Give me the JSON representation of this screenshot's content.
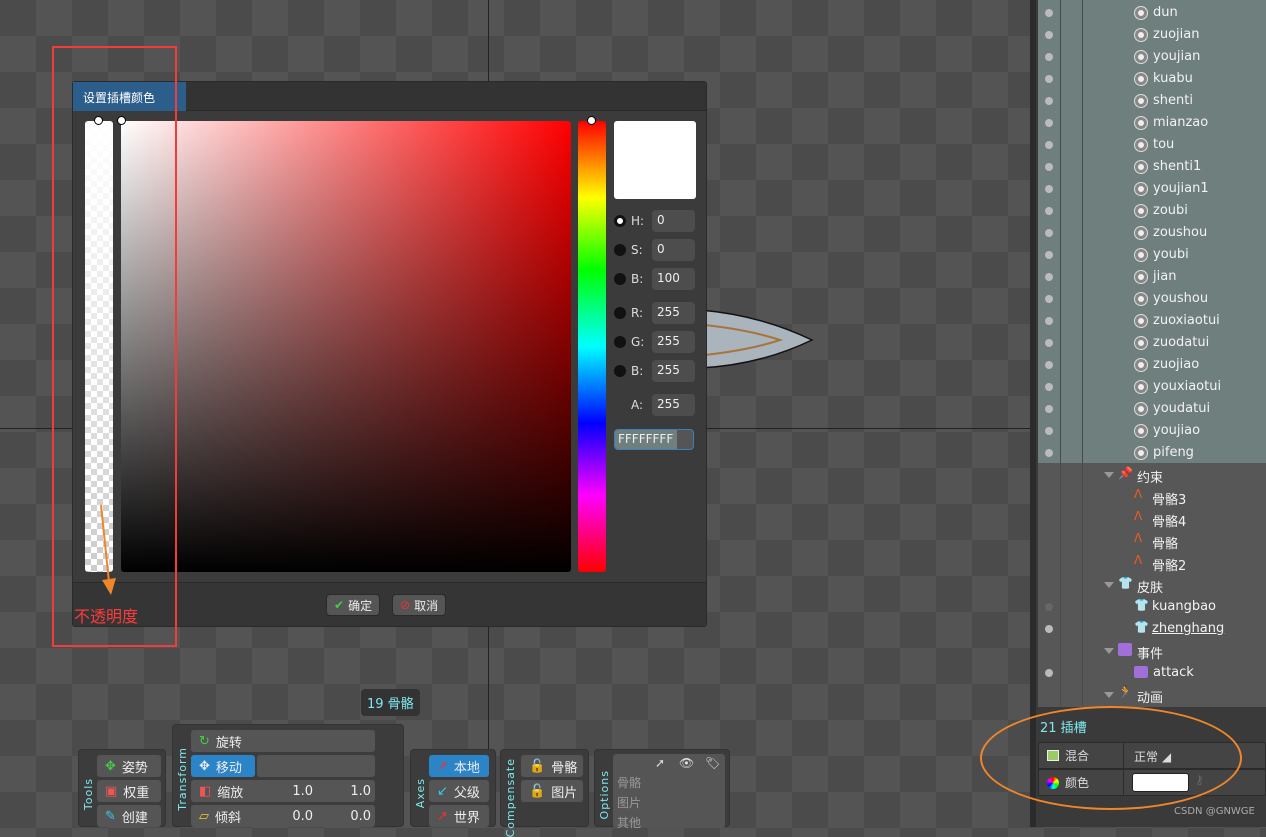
{
  "dialog": {
    "title": "设置插槽颜色",
    "fields": [
      {
        "label": "H:",
        "value": "0",
        "selected": true
      },
      {
        "label": "S:",
        "value": "0"
      },
      {
        "label": "B:",
        "value": "100"
      },
      {
        "label": "R:",
        "value": "255"
      },
      {
        "label": "G:",
        "value": "255"
      },
      {
        "label": "B:",
        "value": "255"
      }
    ],
    "alpha": {
      "label": "A:",
      "value": "255"
    },
    "hex": "FFFFFFFF",
    "ok": "确定",
    "cancel": "取消",
    "color": "#FFFFFF"
  },
  "annotation": {
    "text": "不透明度",
    "color": "#ff3a3a"
  },
  "viewport": {
    "bones_count": "19 骨骼"
  },
  "tree": {
    "slots": [
      "dun",
      "zuojian",
      "youjian",
      "kuabu",
      "shenti",
      "mianzao",
      "tou",
      "shenti1",
      "youjian1",
      "zoubi",
      "zoushou",
      "youbi",
      "jian",
      "youshou",
      "zuoxiaotui",
      "zuodatui",
      "zuojiao",
      "youxiaotui",
      "youdatui",
      "youjiao",
      "pifeng"
    ],
    "constraints": {
      "label": "约束",
      "items": [
        "骨骼3",
        "骨骼4",
        "骨骼",
        "骨骼2"
      ]
    },
    "skins": {
      "label": "皮肤",
      "items": [
        "kuangbao",
        "zhenghang"
      ]
    },
    "events": {
      "label": "事件",
      "items": [
        "attack"
      ]
    },
    "animations": {
      "label": "动画"
    }
  },
  "properties": {
    "title": "21 插槽",
    "blend_label": "混合",
    "blend_value": "正常",
    "color_label": "颜色",
    "color_value": "#FFFFFF"
  },
  "toolbar": {
    "tools": {
      "label": "Tools",
      "items": [
        "姿势",
        "权重",
        "创建"
      ]
    },
    "transform": {
      "label": "Transform",
      "rotate": "旋转",
      "translate": "移动",
      "scale": "缩放",
      "scale_x": "1.0",
      "scale_y": "1.0",
      "shear": "倾斜",
      "shear_x": "0.0",
      "shear_y": "0.0"
    },
    "axes": {
      "label": "Axes",
      "items": [
        "本地",
        "父级",
        "世界"
      ]
    },
    "compensate": {
      "label": "Compensate",
      "items": [
        "骨骼",
        "图片"
      ]
    },
    "options": {
      "label": "Options",
      "rows": [
        "骨骼",
        "图片",
        "其他"
      ]
    }
  },
  "watermark": "CSDN @GNWGE"
}
